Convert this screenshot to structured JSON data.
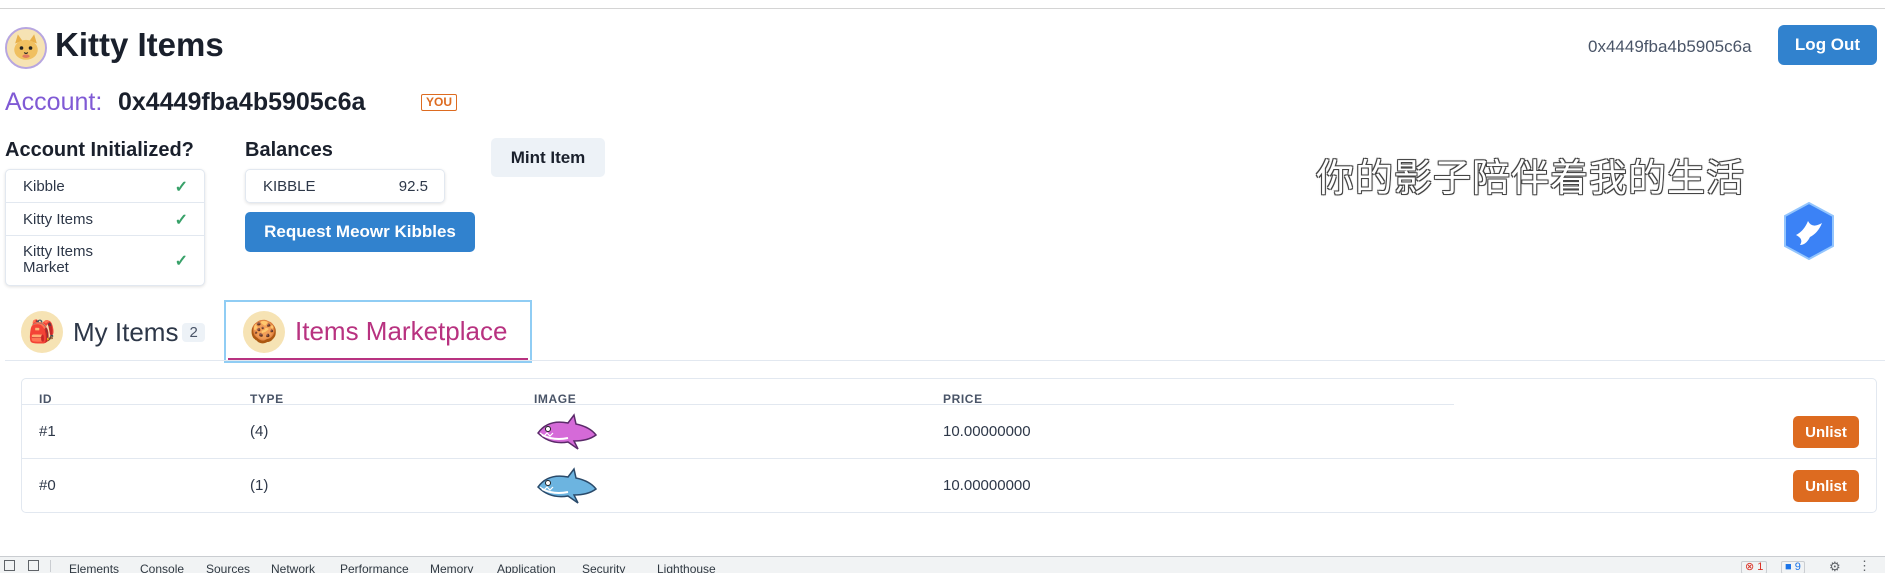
{
  "header": {
    "app_title": "Kitty Items",
    "address": "0x4449fba4b5905c6a",
    "logout_label": "Log Out"
  },
  "account": {
    "label": "Account:",
    "address": "0x4449fba4b5905c6a",
    "you_badge": "YOU"
  },
  "initialized": {
    "heading": "Account Initialized?",
    "items": [
      {
        "label": "Kibble",
        "status": "check"
      },
      {
        "label": "Kitty Items",
        "status": "check"
      },
      {
        "label": "Kitty Items Market",
        "status": "check"
      }
    ]
  },
  "balances": {
    "heading": "Balances",
    "token": "KIBBLE",
    "amount": "92.5",
    "request_label": "Request Meowr Kibbles"
  },
  "mint_label": "Mint Item",
  "overlay_text": "你的影子陪伴着我的生活",
  "tabs": [
    {
      "label": "My Items",
      "count": "2",
      "icon": "backpack-icon",
      "selected": false
    },
    {
      "label": "Items Marketplace",
      "icon": "cookie-icon",
      "selected": true
    }
  ],
  "table": {
    "columns": [
      "ID",
      "TYPE",
      "IMAGE",
      "PRICE"
    ],
    "rows": [
      {
        "id": "#1",
        "type": "(4)",
        "image": "pink-shark",
        "price": "10.00000000",
        "action": "Unlist"
      },
      {
        "id": "#0",
        "type": "(1)",
        "image": "blue-shark",
        "price": "10.00000000",
        "action": "Unlist"
      }
    ]
  },
  "devtools": {
    "tabs": [
      "Elements",
      "Console",
      "Sources",
      "Network",
      "Performance",
      "Memory",
      "Application",
      "Security",
      "Lighthouse"
    ],
    "errors": "1",
    "messages": "9"
  },
  "colors": {
    "primary": "#3182ce",
    "accent_purple": "#805ad5",
    "marketplace_pink": "#b83280",
    "unlist_orange": "#dd6b20",
    "check_green": "#38a169"
  }
}
